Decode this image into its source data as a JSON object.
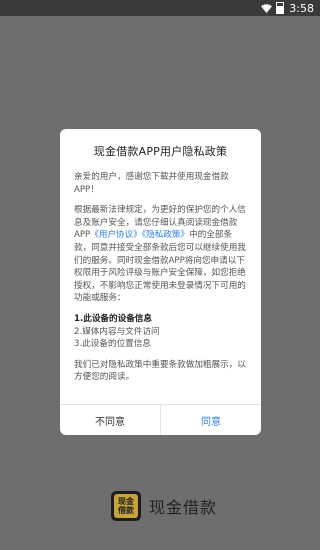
{
  "status_bar": {
    "time": "3:58"
  },
  "dialog": {
    "title": "现金借款APP用户隐私政策",
    "greeting": "亲爱的用户，感谢您下载并使用现金借款APP！",
    "para_part1": "根据最新法律规定，为更好的保护您的个人信息及账户安全，请您仔细认真阅读现金借款APP",
    "link_agreement": "《用户协议》",
    "link_privacy": "《隐私政策》",
    "para_part2": "中的全部条款，同意并接受全部条款后您可以继续使用我们的服务。同时现金借款APP将向您申请以下权限用于风险评级与账户安全保障，如您拒绝授权，不影响您正常使用未登录情况下可用的功能或服务：",
    "section_title": "1.此设备的设备信息",
    "item2": "2.媒体内容与文件访问",
    "item3": "3.此设备的位置信息",
    "closing": "我们已对隐私政策中重要条款做加粗展示，以方便您的阅读。",
    "disagree_label": "不同意",
    "agree_label": "同意"
  },
  "brand": {
    "logo_text_line1": "现金",
    "logo_text_line2": "借款",
    "app_name": "现金借款"
  },
  "colors": {
    "accent": "#2f80ed",
    "overlay": "#6e6e6e",
    "logo_gold": "#c7a33a"
  }
}
